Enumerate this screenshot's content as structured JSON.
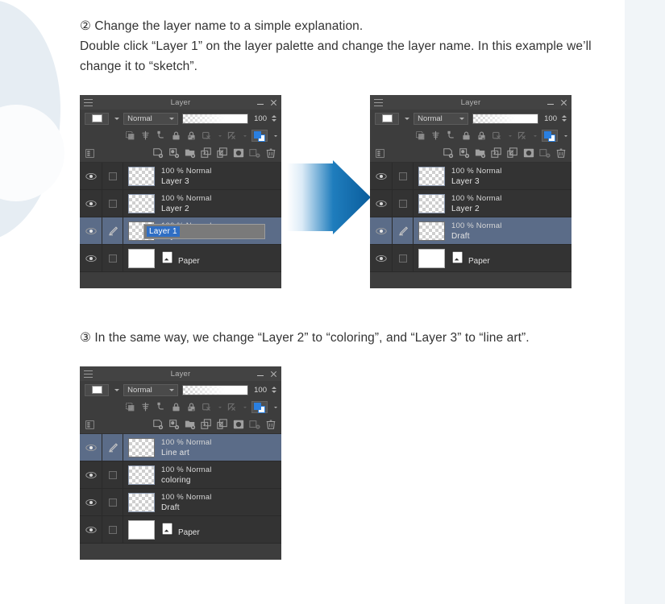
{
  "paragraphs": {
    "step2_line1": "② Change the layer name to a simple explanation.",
    "step2_line2": "Double click “Layer 1” on the layer palette and change the layer name. In this example we’ll change it to “sketch”.",
    "step3": "③ In the same way, we change “Layer 2” to “coloring”, and “Layer 3” to “line art”."
  },
  "palette_chrome": {
    "title": "Layer",
    "blend_mode": "Normal",
    "opacity": "100",
    "minimize_label": "—",
    "close_label": "×"
  },
  "toolbar_icons": {
    "row2": [
      "clip-to-layer-below-icon",
      "mask-apply-icon",
      "ruler-lock-icon",
      "lock-layer-icon",
      "lock-transparency-icon",
      "mask-enable-icon",
      "mask-disable-icon",
      "draw-color-swatch-icon"
    ],
    "row3_left": "palette-menu-icon",
    "row3": [
      "new-raster-layer-icon",
      "new-tone-layer-icon",
      "new-folder-icon",
      "transfer-down-icon",
      "merge-down-icon",
      "layer-mask-icon",
      "link-layers-icon",
      "delete-layer-icon"
    ]
  },
  "palette_before": {
    "layers": [
      {
        "blend": "100 % Normal",
        "name": "Layer 3",
        "selected": false,
        "type": "raster"
      },
      {
        "blend": "100 % Normal",
        "name": "Layer 2",
        "selected": false,
        "type": "raster"
      },
      {
        "blend": "100 % Normal",
        "name": "Layer 1",
        "selected": true,
        "type": "raster",
        "editing": true,
        "edit_value": "Layer 1"
      },
      {
        "blend": "",
        "name": "Paper",
        "selected": false,
        "type": "paper"
      }
    ]
  },
  "palette_after": {
    "layers": [
      {
        "blend": "100 % Normal",
        "name": "Layer 3",
        "selected": false,
        "type": "raster"
      },
      {
        "blend": "100 % Normal",
        "name": "Layer 2",
        "selected": false,
        "type": "raster"
      },
      {
        "blend": "100 % Normal",
        "name": "Draft",
        "selected": true,
        "type": "raster"
      },
      {
        "blend": "",
        "name": "Paper",
        "selected": false,
        "type": "paper"
      }
    ]
  },
  "palette_final": {
    "layers": [
      {
        "blend": "100 % Normal",
        "name": "Line art",
        "selected": true,
        "type": "raster"
      },
      {
        "blend": "100 % Normal",
        "name": "coloring",
        "selected": false,
        "type": "raster"
      },
      {
        "blend": "100 % Normal",
        "name": "Draft",
        "selected": false,
        "type": "raster"
      },
      {
        "blend": "",
        "name": "Paper",
        "selected": false,
        "type": "paper"
      }
    ]
  },
  "arrow": {
    "name": "right-arrow",
    "color_start": "#f4f9fd",
    "color_end": "#0d6bac"
  },
  "colors": {
    "panel_bg": "#3d3d3d",
    "list_bg": "#333333",
    "selected_row": "#5b6c88",
    "text": "#d6d6d6",
    "page_text": "#333333",
    "page_bg": "#ffffff",
    "decor_bg": "#f1f5f8",
    "accent_blue": "#2a7fe0",
    "selection_blue": "#2f6ec4"
  }
}
